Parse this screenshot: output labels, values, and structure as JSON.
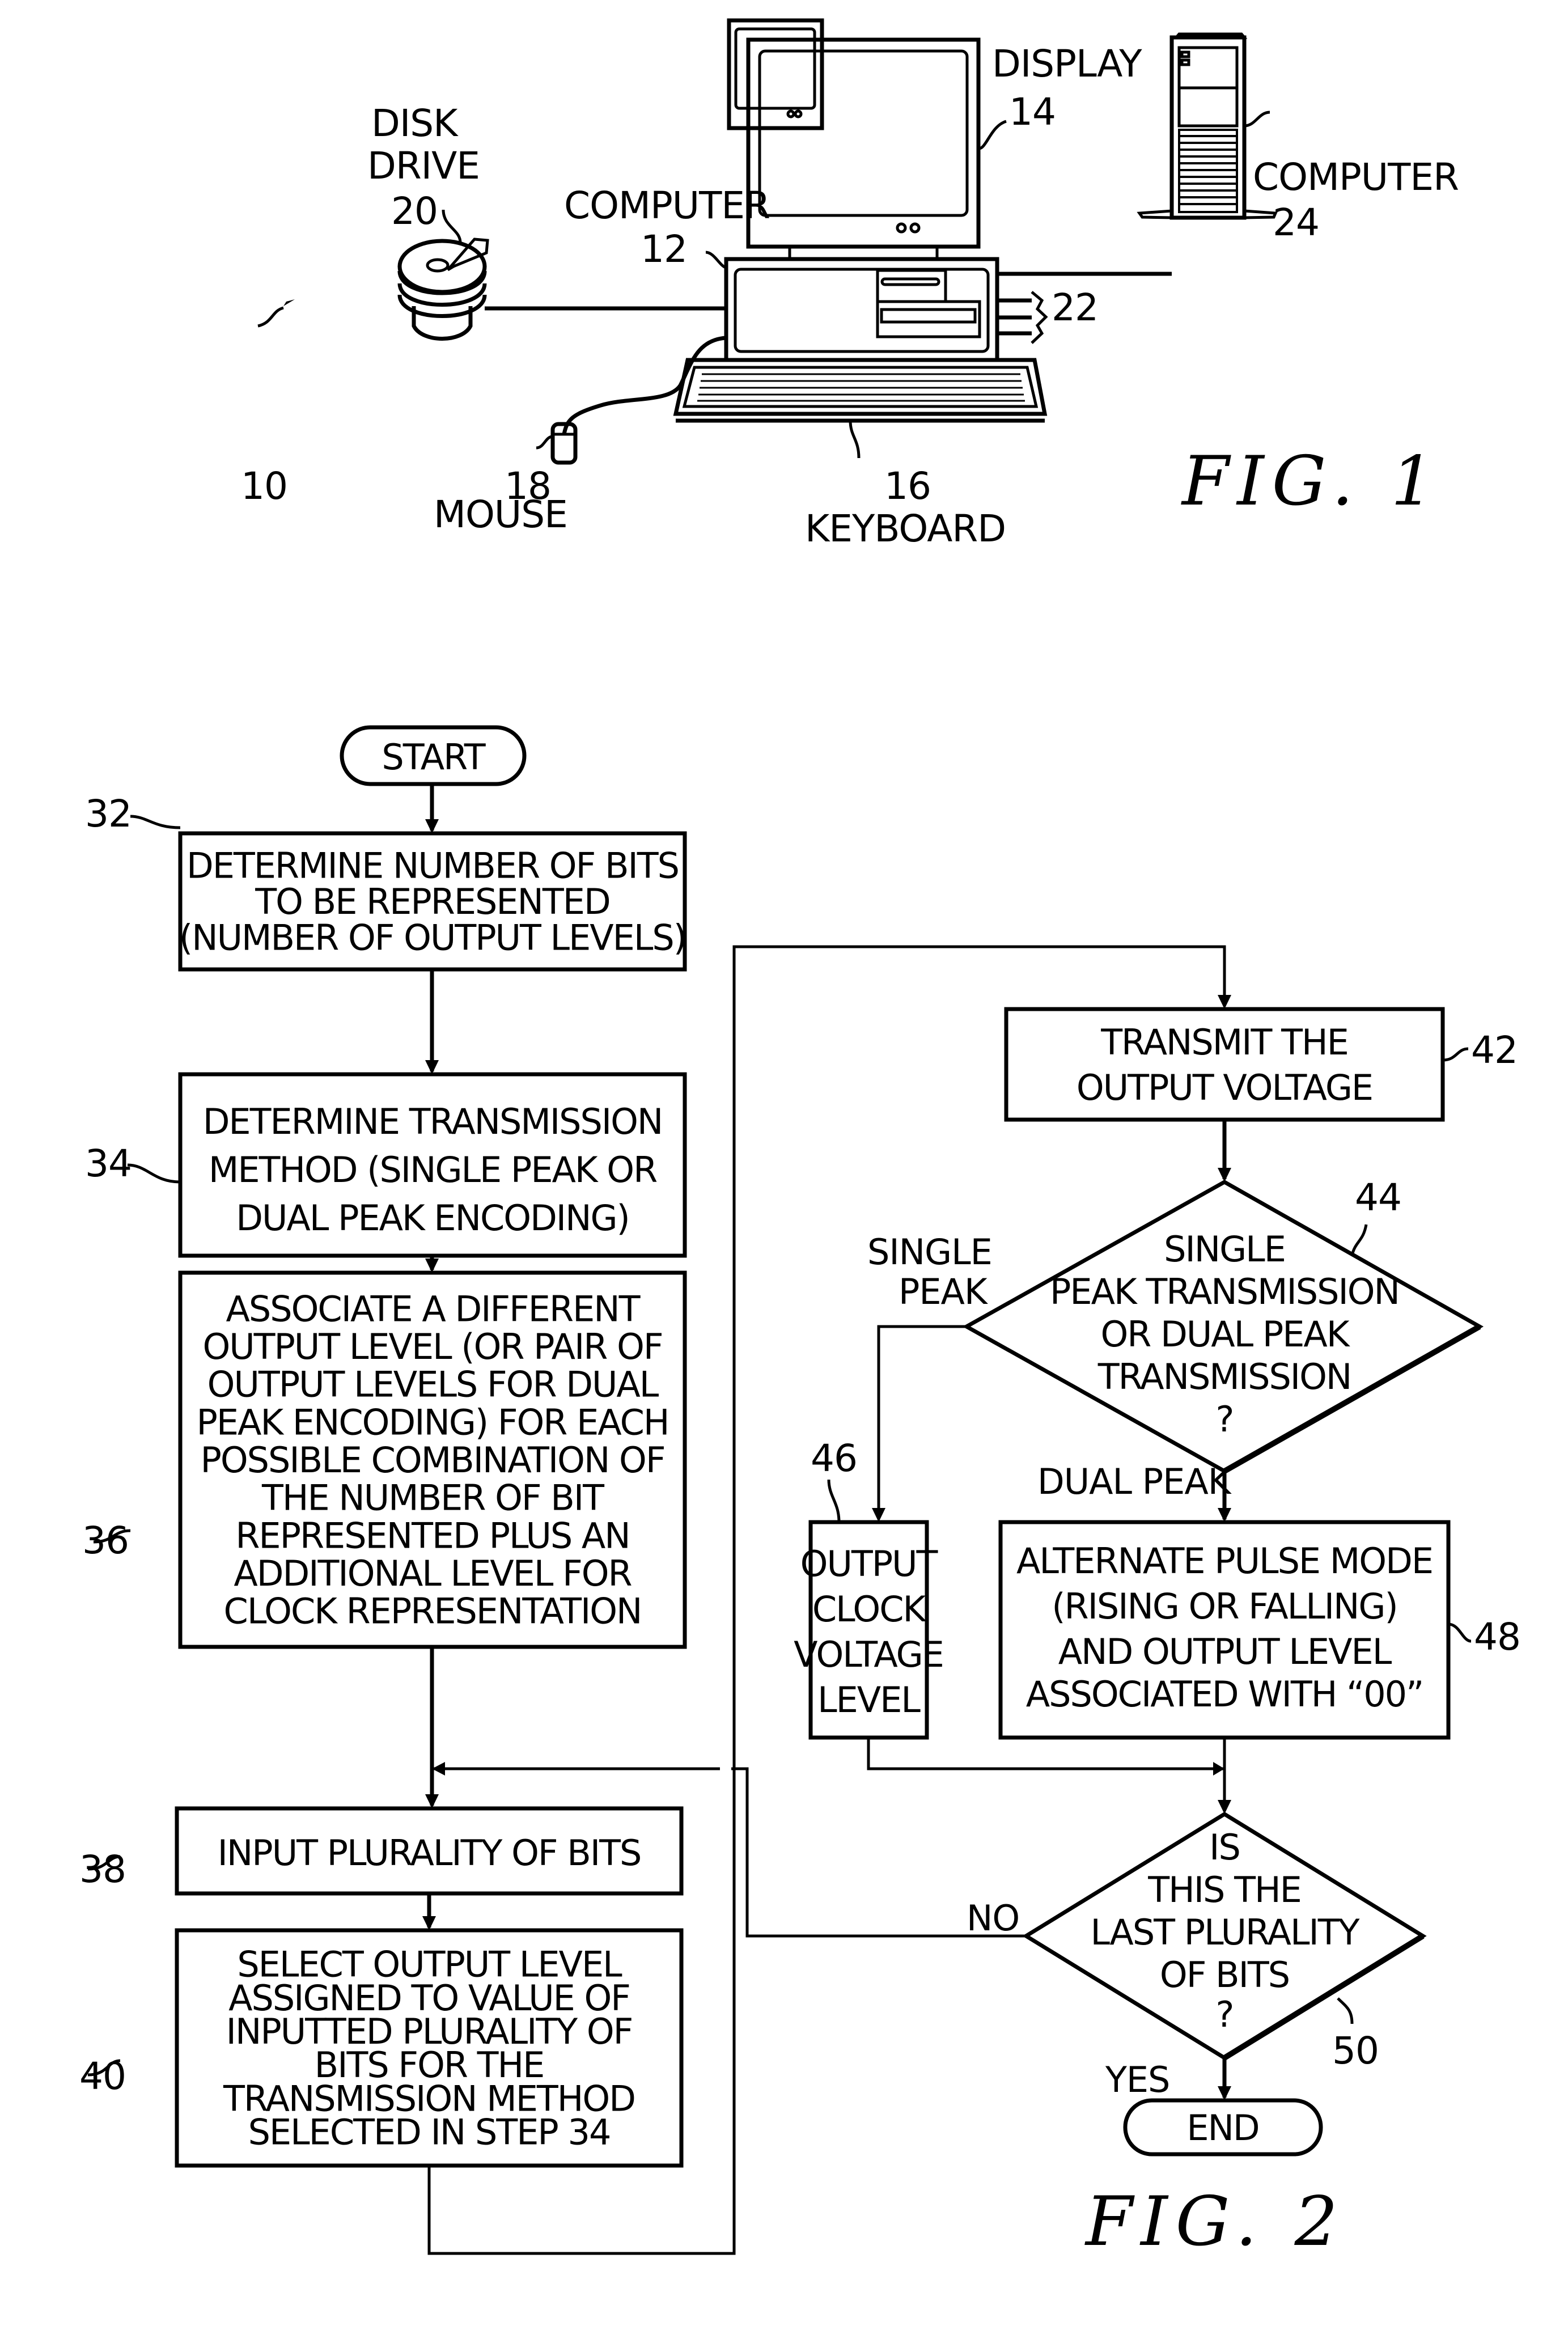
{
  "fig1": {
    "caption": "FIG. 1",
    "system_ref": "10",
    "components": {
      "display": {
        "label": "DISPLAY",
        "ref": "14"
      },
      "computer_12": {
        "label": "COMPUTER",
        "ref": "12"
      },
      "computer_24": {
        "label": "COMPUTER",
        "ref": "24"
      },
      "disk_drive": {
        "label_lines": [
          "DISK",
          "DRIVE"
        ],
        "ref": "20"
      },
      "mouse": {
        "label": "MOUSE",
        "ref": "18"
      },
      "keyboard": {
        "label": "KEYBOARD",
        "ref": "16"
      },
      "connections": {
        "ref": "22"
      }
    }
  },
  "fig2": {
    "caption": "FIG. 2",
    "start": "START",
    "end": "END",
    "steps": {
      "s32": {
        "ref": "32",
        "lines": [
          "DETERMINE NUMBER OF BITS",
          "TO BE REPRESENTED",
          "(NUMBER OF OUTPUT LEVELS)"
        ]
      },
      "s34": {
        "ref": "34",
        "lines": [
          "DETERMINE TRANSMISSION",
          "METHOD (SINGLE PEAK OR",
          "DUAL PEAK ENCODING)"
        ]
      },
      "s36": {
        "ref": "36",
        "lines": [
          "ASSOCIATE A DIFFERENT",
          "OUTPUT LEVEL (OR PAIR OF",
          "OUTPUT LEVELS FOR DUAL",
          "PEAK ENCODING) FOR EACH",
          "POSSIBLE COMBINATION OF",
          "THE NUMBER OF BIT",
          "REPRESENTED PLUS AN",
          "ADDITIONAL LEVEL FOR",
          "CLOCK REPRESENTATION"
        ]
      },
      "s38": {
        "ref": "38",
        "lines": [
          "INPUT PLURALITY OF BITS"
        ]
      },
      "s40": {
        "ref": "40",
        "lines": [
          "SELECT OUTPUT LEVEL",
          "ASSIGNED TO VALUE OF",
          "INPUTTED PLURALITY OF",
          "BITS FOR THE",
          "TRANSMISSION METHOD",
          "SELECTED IN STEP 34"
        ]
      },
      "s42": {
        "ref": "42",
        "lines": [
          "TRANSMIT THE",
          "OUTPUT VOLTAGE"
        ]
      },
      "s44": {
        "ref": "44",
        "lines": [
          "SINGLE",
          "PEAK TRANSMISSION",
          "OR DUAL PEAK",
          "TRANSMISSION",
          "?"
        ]
      },
      "s46": {
        "ref": "46",
        "lines": [
          "OUTPUT",
          "CLOCK",
          "VOLTAGE",
          "LEVEL"
        ]
      },
      "s48": {
        "ref": "48",
        "lines": [
          "ALTERNATE PULSE MODE",
          "(RISING OR FALLING)",
          "AND OUTPUT LEVEL",
          "ASSOCIATED WITH “00”"
        ]
      },
      "s50": {
        "ref": "50",
        "lines": [
          "IS",
          "THIS THE",
          "LAST PLURALITY",
          "OF BITS",
          "?"
        ]
      }
    },
    "branch_labels": {
      "single_peak": [
        "SINGLE",
        "PEAK"
      ],
      "dual_peak": "DUAL PEAK",
      "no": "NO",
      "yes": "YES"
    }
  }
}
